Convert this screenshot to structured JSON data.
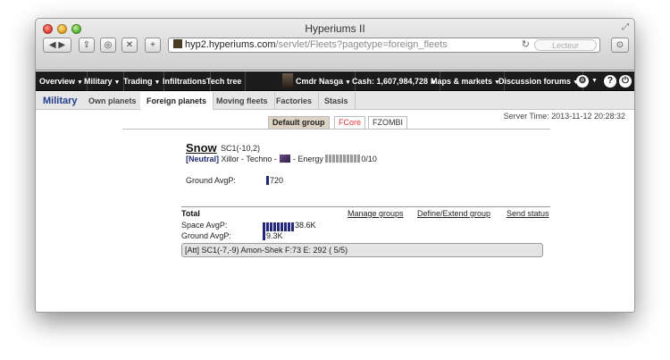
{
  "window": {
    "title": "Hyperiums II"
  },
  "toolbar": {
    "url_host": "hyp2.hyperiums.com",
    "url_path": "/servlet/Fleets?pagetype=foreign_fleets",
    "reader_label": "Lecteur"
  },
  "nav": {
    "items": [
      {
        "label": "Overview"
      },
      {
        "label": "Military"
      },
      {
        "label": "Trading"
      },
      {
        "label": "Infiltrations"
      },
      {
        "label": "Tech tree"
      },
      {
        "label": "Cmdr Nasga"
      },
      {
        "label": "Cash: 1,607,984,728"
      },
      {
        "label": "Maps & markets"
      },
      {
        "label": "Discussion forums"
      }
    ]
  },
  "subnav": {
    "title": "Military",
    "items": [
      {
        "label": "Own planets"
      },
      {
        "label": "Foreign planets"
      },
      {
        "label": "Moving fleets"
      },
      {
        "label": "Factories"
      },
      {
        "label": "Stasis"
      }
    ]
  },
  "server_time": "Server Time: 2013-11-12 20:28:32",
  "group_tabs": [
    "Default group",
    "FCore",
    "FZOMBI"
  ],
  "planet": {
    "name": "Snow",
    "coord": "SC1(-10,2)",
    "status": "[Neutral]",
    "race_techno": "Xillor - Techno -",
    "energy_label": "- Energy",
    "energy_value": "0/10",
    "energy_level": 0,
    "ground_label": "Ground AvgP:",
    "ground_value": "720"
  },
  "total": {
    "label": "Total",
    "space_label": "Space AvgP:",
    "space_value": "38.6K",
    "ground_label": "Ground AvgP:",
    "ground_value": "9.3K"
  },
  "links": [
    "Manage groups",
    "Define/Extend group",
    "Send status"
  ],
  "fleet": {
    "text": "[Att] SC1(-7,-9) Amon-Shek F:73 E: 292 ( 5/5)"
  },
  "colors": {
    "nav_bg": "#1c1c1c",
    "title_blue": "#1f3e8c",
    "bar": "#24287a",
    "fcore": "#e03030"
  }
}
